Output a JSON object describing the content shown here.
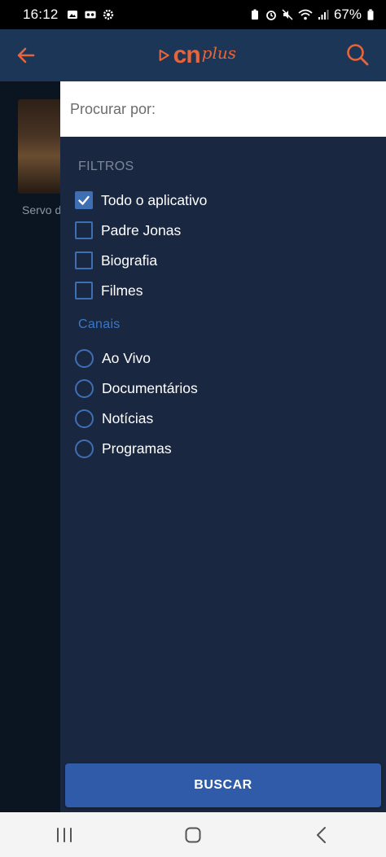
{
  "status_bar": {
    "time": "16:12",
    "battery": "67%"
  },
  "header": {
    "logo_cn": "cn",
    "logo_plus": "plus"
  },
  "background": {
    "item_title": "Servo de Deus"
  },
  "drawer": {
    "search_placeholder": "Procurar por:",
    "filters_title": "FILTROS",
    "filters": [
      {
        "label": "Todo o aplicativo",
        "checked": true
      },
      {
        "label": "Padre Jonas",
        "checked": false
      },
      {
        "label": "Biografia",
        "checked": false
      },
      {
        "label": "Filmes",
        "checked": false
      }
    ],
    "channels_title": "Canais",
    "channels": [
      {
        "label": "Ao Vivo"
      },
      {
        "label": "Documentários"
      },
      {
        "label": "Notícias"
      },
      {
        "label": "Programas"
      }
    ],
    "search_button": "BUSCAR"
  },
  "colors": {
    "accent_orange": "#e8643a",
    "header_blue": "#1b3657",
    "drawer_bg": "#1a2740",
    "control_blue": "#3f6fb3",
    "button_blue": "#2f5ba8"
  }
}
